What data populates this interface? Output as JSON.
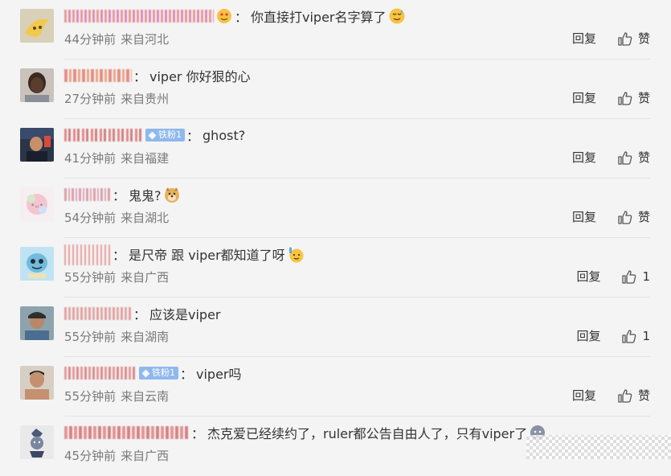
{
  "comments": [
    {
      "text": "你直接打viper名字算了",
      "time": "44分钟前",
      "location": "来自河北",
      "reply_label": "回复",
      "like_label": "赞",
      "avatar_icon": "banana-avatar",
      "emoji_icon": "sweat-smile-emoji"
    },
    {
      "text": "viper 你好狠的心",
      "time": "27分钟前",
      "location": "来自贵州",
      "reply_label": "回复",
      "like_label": "赞",
      "avatar_icon": "person-avatar"
    },
    {
      "text": "ghost?",
      "badge": "铁粉1",
      "time": "41分钟前",
      "location": "来自福建",
      "reply_label": "回复",
      "like_label": "赞",
      "avatar_icon": "player-avatar"
    },
    {
      "text": "鬼鬼?",
      "time": "54分钟前",
      "location": "来自湖北",
      "reply_label": "回复",
      "like_label": "赞",
      "avatar_icon": "pastel-sticker-avatar",
      "emoji_icon": "doge-emoji"
    },
    {
      "text": "是尺帝 跟 viper都知道了呀",
      "time": "55分钟前",
      "location": "来自广西",
      "reply_label": "回复",
      "like_label": "1",
      "avatar_icon": "squirtle-avatar",
      "emoji_icon": "raise-hand-emoji"
    },
    {
      "text": "应该是viper",
      "time": "55分钟前",
      "location": "来自湖南",
      "reply_label": "回复",
      "like_label": "1",
      "avatar_icon": "person-avatar-cap"
    },
    {
      "text": "viper吗",
      "badge": "铁粉1",
      "time": "55分钟前",
      "location": "来自云南",
      "reply_label": "回复",
      "like_label": "赞",
      "avatar_icon": "man-avatar"
    },
    {
      "text": "杰克爱已经续约了，ruler都公告自由人了，只有viper了",
      "time": "45分钟前",
      "location": "来自广西",
      "avatar_icon": "cartoon-avatar",
      "emoji_icon": "sad-emoji"
    }
  ],
  "colors": {
    "background": "#f4f4f4",
    "badge": "#8fb8ec",
    "username_blur": "#e8878f",
    "meta_text": "#7a7a7a"
  }
}
